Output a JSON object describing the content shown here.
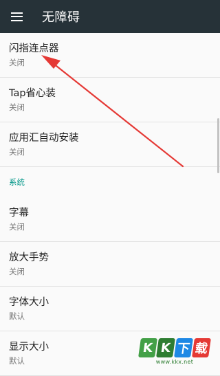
{
  "appbar": {
    "title": "无障碍",
    "menu_icon": "hamburger-menu-icon"
  },
  "items_top": [
    {
      "label": "闪指连点器",
      "status": "关闭"
    },
    {
      "label": "Tap省心装",
      "status": "关闭"
    },
    {
      "label": "应用汇自动安装",
      "status": "关闭"
    }
  ],
  "section_system": "系统",
  "items_system": [
    {
      "label": "字幕",
      "status": "关闭"
    },
    {
      "label": "放大手势",
      "status": "关闭"
    },
    {
      "label": "字体大小",
      "status": "默认"
    },
    {
      "label": "显示大小",
      "status": "默认"
    }
  ],
  "colors": {
    "appbar": "#263238",
    "section_accent": "#009688",
    "arrow": "#e53935"
  },
  "watermark": {
    "logo": [
      "K",
      "K",
      "下",
      "载"
    ],
    "url": "www.kkx.net"
  }
}
